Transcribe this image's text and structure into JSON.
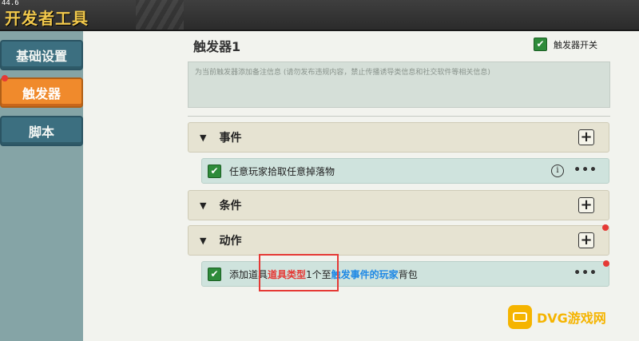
{
  "fps": "44.6",
  "app_title": "开发者工具",
  "sidebar": {
    "items": [
      {
        "label": "基础设置",
        "active": false
      },
      {
        "label": "触发器",
        "active": true
      },
      {
        "label": "脚本",
        "active": false
      }
    ]
  },
  "trigger": {
    "name": "触发器1",
    "toggle_label": "触发器开关",
    "toggle_checked": true,
    "note_placeholder": "为当前触发器添加备注信息 (请勿发布违规内容，禁止传播诱导类信息和社交软件等相关信息)"
  },
  "sections": {
    "events": {
      "label": "事件"
    },
    "conditions": {
      "label": "条件"
    },
    "actions": {
      "label": "动作"
    }
  },
  "event_item": {
    "text": "任意玩家拾取任意掉落物",
    "info_icon": "i",
    "more": "•••"
  },
  "action_item": {
    "text_1": "添加道具",
    "text_red": "道具类型",
    "text_2": "1个至",
    "text_blue": "触发事件的玩家",
    "text_3": "背包",
    "more": "•••"
  },
  "icons": {
    "check": "✔",
    "plus": "+",
    "triangle": "▼"
  },
  "watermark": {
    "text": "DVG游戏网"
  },
  "colors": {
    "accent_orange": "#f08a2c",
    "sidebar_teal": "#3c6f80",
    "check_green": "#2e8b3a",
    "highlight_red": "#e53935",
    "link_blue": "#1e88e5"
  }
}
